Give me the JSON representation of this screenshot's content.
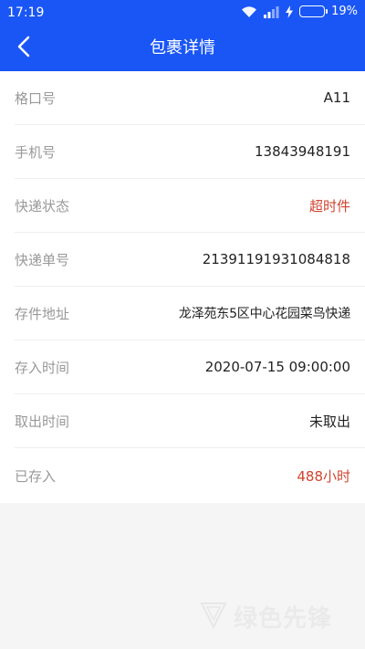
{
  "status_bar": {
    "time": "17:19",
    "battery_level": "19%",
    "battery_fraction": 0.19,
    "icons": [
      "wifi-icon",
      "signal-icon",
      "charging-icon",
      "battery-icon"
    ]
  },
  "header": {
    "title": "包裹详情",
    "back_icon": "chevron-left-icon",
    "accent_color": "#1a56f5"
  },
  "details": [
    {
      "label": "格口号",
      "value": "A11"
    },
    {
      "label": "手机号",
      "value": "13843948191"
    },
    {
      "label": "快递状态",
      "value": "超时件"
    },
    {
      "label": "快递单号",
      "value": "21391191931084818"
    },
    {
      "label": "存件地址",
      "value": "龙泽苑东5区中心花园菜鸟快递"
    },
    {
      "label": "存入时间",
      "value": "2020-07-15 09:00:00"
    },
    {
      "label": "取出时间",
      "value": "未取出"
    },
    {
      "label": "已存入",
      "value": "488小时"
    }
  ],
  "colors": {
    "highlight_red": "#d0442f",
    "label_gray": "#999999"
  },
  "watermark": {
    "text": "绿色先锋"
  }
}
